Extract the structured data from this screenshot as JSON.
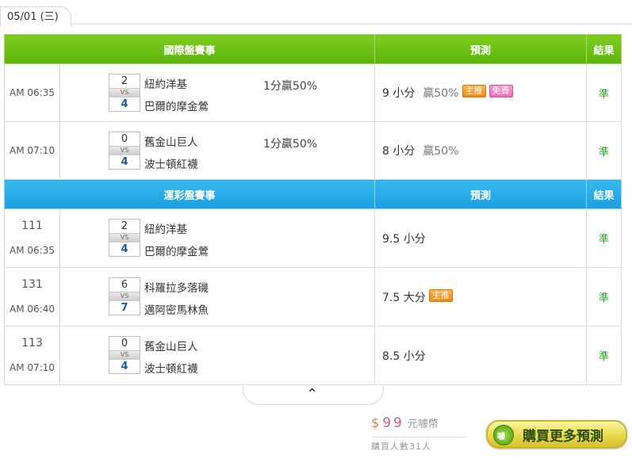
{
  "date_tab": "05/01 (三)",
  "intl": {
    "header": {
      "title": "國際盤賽事",
      "prediction": "預測",
      "result": "結果"
    },
    "rows": [
      {
        "time": "AM 06:35",
        "score1": "2",
        "vs": "VS",
        "score2": "4",
        "team1": "紐約洋基",
        "team2": "巴爾的摩金鶯",
        "handicap": "1分贏50%",
        "pred_main": "9 小分",
        "pred_sub": "贏50%",
        "badges": [
          "主推",
          "免費"
        ],
        "result": "準"
      },
      {
        "time": "AM 07:10",
        "score1": "0",
        "vs": "VS",
        "score2": "4",
        "team1": "舊金山巨人",
        "team2": "波士頓紅襪",
        "handicap": "1分贏50%",
        "pred_main": "8 小分",
        "pred_sub": "贏50%",
        "badges": [],
        "result": "準"
      }
    ]
  },
  "sports": {
    "header": {
      "title": "運彩盤賽事",
      "prediction": "預測",
      "result": "結果"
    },
    "rows": [
      {
        "id": "111",
        "time": "AM 06:35",
        "score1": "2",
        "vs": "VS",
        "score2": "4",
        "team1": "紐約洋基",
        "team2": "巴爾的摩金鶯",
        "pred_main": "9.5 小分",
        "badges": [],
        "result": "準"
      },
      {
        "id": "131",
        "time": "AM 06:40",
        "score1": "6",
        "vs": "VS",
        "score2": "7",
        "team1": "科羅拉多落磯",
        "team2": "邁阿密馬林魚",
        "pred_main": "7.5 大分",
        "badges": [
          "主推"
        ],
        "result": "準"
      },
      {
        "id": "113",
        "time": "AM 07:10",
        "score1": "0",
        "vs": "VS",
        "score2": "4",
        "team1": "舊金山巨人",
        "team2": "波士頓紅襪",
        "pred_main": "8.5 小分",
        "badges": [],
        "result": "準"
      }
    ]
  },
  "collapse_icon": "chevron-up-icon",
  "price": {
    "currency": "$",
    "amount": "99",
    "unit": "元噱幣",
    "buyers": "購買人數31人"
  },
  "buy_button": {
    "label": "購買更多預測",
    "icon_text": "噱"
  }
}
